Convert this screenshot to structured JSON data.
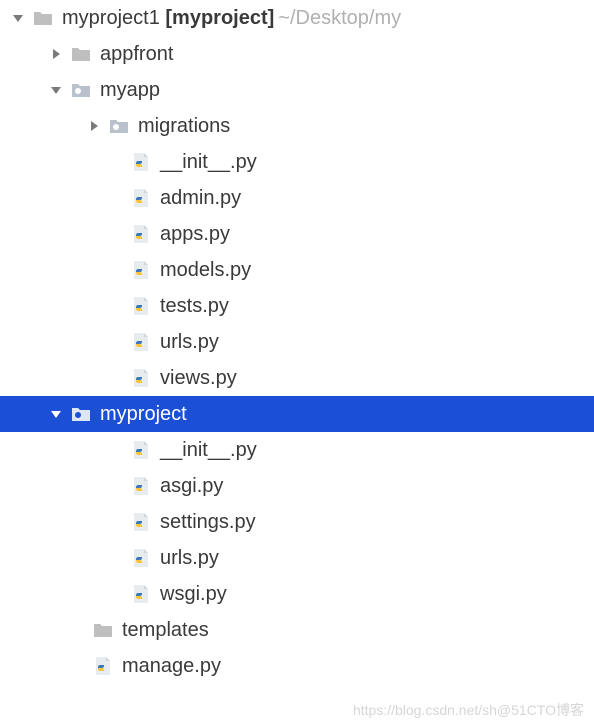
{
  "root": {
    "name_prefix": "myproject1 ",
    "name_bold": "[myproject]",
    "path_suffix": "~/Desktop/my"
  },
  "nodes": {
    "appfront": "appfront",
    "myapp": "myapp",
    "migrations": "migrations",
    "myapp_init": "__init__.py",
    "admin": "admin.py",
    "apps": "apps.py",
    "models": "models.py",
    "tests": "tests.py",
    "urls1": "urls.py",
    "views": "views.py",
    "myproject": "myproject",
    "myproject_init": "__init__.py",
    "asgi": "asgi.py",
    "settings": "settings.py",
    "urls2": "urls.py",
    "wsgi": "wsgi.py",
    "templates": "templates",
    "manage": "manage.py"
  },
  "watermark": "https://blog.csdn.net/sh@51CTO博客"
}
